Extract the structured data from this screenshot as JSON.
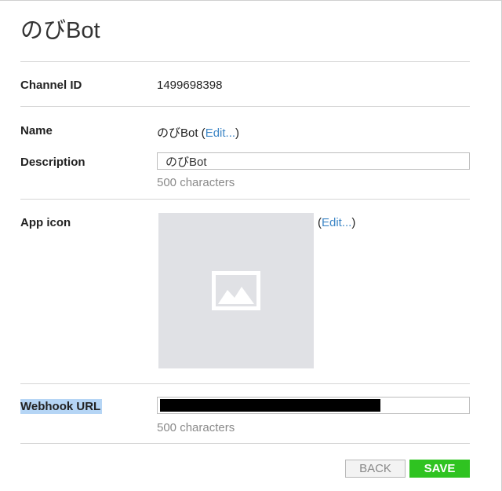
{
  "page": {
    "title": "のびBot"
  },
  "channel_id": {
    "label": "Channel ID",
    "value": "1499698398"
  },
  "name": {
    "label": "Name",
    "value": "のびBot",
    "open_paren": " (",
    "edit_link": "Edit...",
    "close_paren": ")"
  },
  "description": {
    "label": "Description",
    "value": "のびBot",
    "hint": "500 characters"
  },
  "app_icon": {
    "label": "App icon",
    "icon": "image-placeholder-icon",
    "open_paren": "(",
    "edit_link": "Edit...",
    "close_paren": ")"
  },
  "webhook": {
    "label": "Webhook URL",
    "hint": "500 characters"
  },
  "actions": {
    "back_label": "BACK",
    "save_label": "SAVE"
  },
  "colors": {
    "link": "#3d86c6",
    "save_button": "#2fc321",
    "selection_highlight": "#b5d5f5",
    "placeholder_bg": "#e0e1e5"
  }
}
